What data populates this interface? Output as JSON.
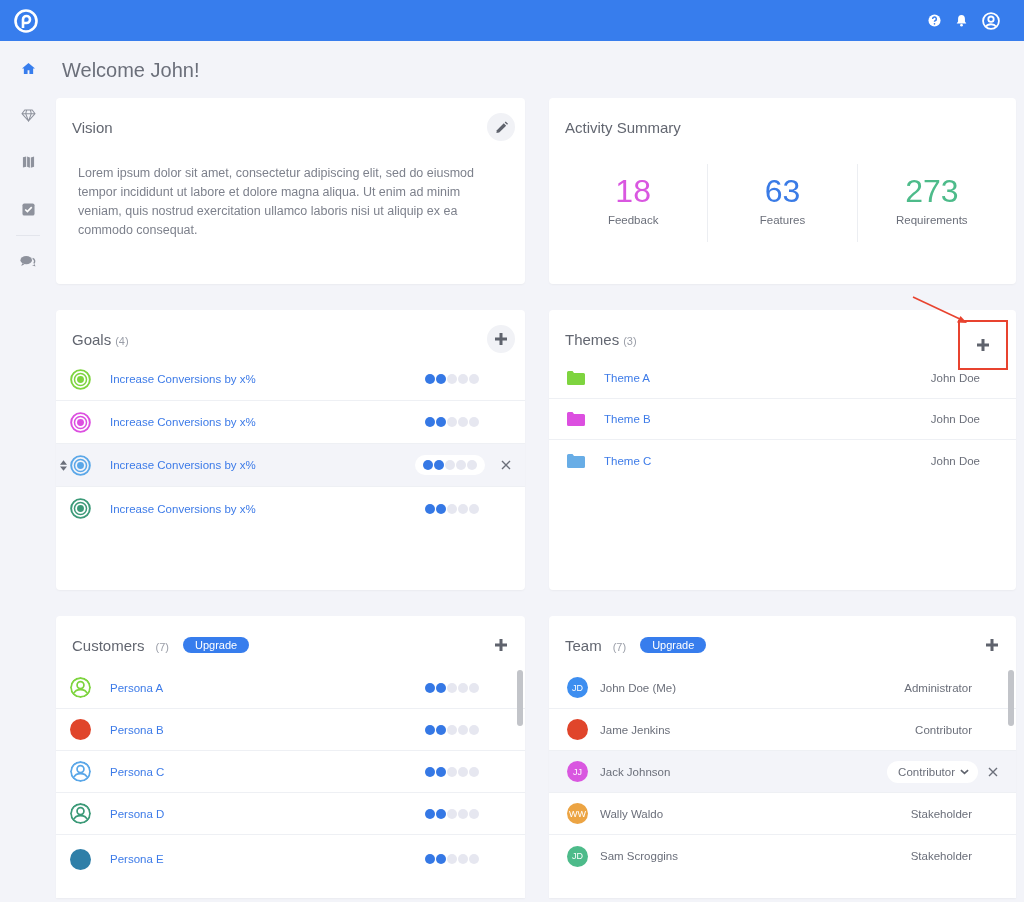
{
  "nav": [
    {
      "kind": "home",
      "selected": true
    },
    {
      "kind": "diamond",
      "selected": false
    },
    {
      "kind": "map",
      "selected": false
    },
    {
      "kind": "tasks",
      "selected": false
    },
    {
      "kind": "chat",
      "selected": false
    }
  ],
  "greeting": "Welcome John!",
  "vision": {
    "title": "Vision",
    "text": "Lorem ipsum dolor sit amet, consectetur adipiscing elit, sed do eiusmod tempor incididunt ut labore et dolore magna aliqua. Ut enim ad minim veniam, quis nostrud exercitation ullamco laboris nisi ut aliquip ex ea commodo consequat."
  },
  "activity": {
    "title": "Activity Summary",
    "stats": [
      {
        "value": "18",
        "label": "Feedback",
        "color": "#d957e0"
      },
      {
        "value": "63",
        "label": "Features",
        "color": "#3a7be6"
      },
      {
        "value": "273",
        "label": "Requirements",
        "color": "#4dbb8a"
      }
    ]
  },
  "goals": {
    "title": "Goals",
    "count": "(4)",
    "items": [
      {
        "name": "Increase Conversions by x%",
        "color": "#7ed43f",
        "stars": 2,
        "highlighted": false
      },
      {
        "name": "Increase Conversions by x%",
        "color": "#dc4fe0",
        "stars": 2,
        "highlighted": false
      },
      {
        "name": "Increase Conversions by x%",
        "color": "#5aa7e8",
        "stars": 2,
        "highlighted": true
      },
      {
        "name": "Increase Conversions by x%",
        "color": "#3c9a78",
        "stars": 2,
        "highlighted": false
      }
    ]
  },
  "themes": {
    "title": "Themes",
    "count": "(3)",
    "callout": true,
    "items": [
      {
        "name": "Theme A",
        "owner": "John Doe",
        "color": "#7ed43f"
      },
      {
        "name": "Theme B",
        "owner": "John Doe",
        "color": "#dc4fe0"
      },
      {
        "name": "Theme C",
        "owner": "John Doe",
        "color": "#68ade6"
      }
    ]
  },
  "customers": {
    "title": "Customers",
    "count": "(7)",
    "badge": "Upgrade",
    "items": [
      {
        "name": "Persona A",
        "kind": "silhouette",
        "color": "#7ed43f",
        "stars": 2
      },
      {
        "name": "Persona B",
        "kind": "photo",
        "color": "#e0452b",
        "stars": 2
      },
      {
        "name": "Persona C",
        "kind": "silhouette",
        "color": "#5aa7e8",
        "stars": 2
      },
      {
        "name": "Persona D",
        "kind": "silhouette",
        "color": "#3c9a78",
        "stars": 2
      },
      {
        "name": "Persona E",
        "kind": "photo",
        "color": "#2f7fa8",
        "stars": 2
      }
    ]
  },
  "team": {
    "title": "Team",
    "count": "(7)",
    "badge": "Upgrade",
    "members": [
      {
        "name": "John Doe (Me)",
        "kind": "initials",
        "initials": "JD",
        "color": "#3d8ef0",
        "role": "Administrator",
        "highlighted": false
      },
      {
        "name": "Jame Jenkins",
        "kind": "photo",
        "color": "#e0452b",
        "role": "Contributor",
        "highlighted": false
      },
      {
        "name": "Jack Johnson",
        "kind": "initials",
        "initials": "JJ",
        "color": "#d957e0",
        "role": "Contributor",
        "highlighted": true
      },
      {
        "name": "Wally Waldo",
        "kind": "initials",
        "initials": "WW",
        "color": "#eca443",
        "role": "Stakeholder",
        "highlighted": false
      },
      {
        "name": "Sam Scroggins",
        "kind": "initials",
        "initials": "JD",
        "color": "#4dbb8a",
        "role": "Stakeholder",
        "highlighted": false
      }
    ]
  }
}
